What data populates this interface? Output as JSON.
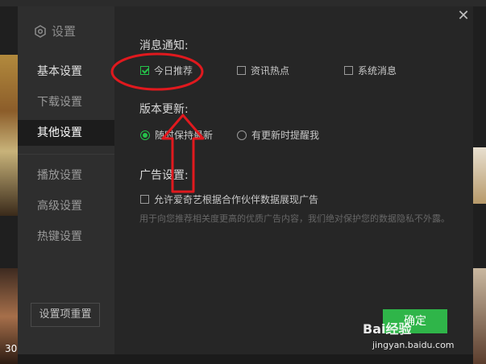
{
  "sidebar": {
    "title": "设置",
    "items": [
      {
        "label": "基本设置"
      },
      {
        "label": "下载设置"
      },
      {
        "label": "其他设置"
      },
      {
        "label": "播放设置"
      },
      {
        "label": "高级设置"
      },
      {
        "label": "热键设置"
      }
    ],
    "reset_label": "设置项重置"
  },
  "sections": {
    "notify": {
      "title": "消息通知:",
      "options": [
        {
          "label": "今日推荐",
          "checked": true
        },
        {
          "label": "资讯热点",
          "checked": false
        },
        {
          "label": "系统消息",
          "checked": false
        }
      ]
    },
    "update": {
      "title": "版本更新:",
      "options": [
        {
          "label": "随时保持最新",
          "selected": true
        },
        {
          "label": "有更新时提醒我",
          "selected": false
        }
      ]
    },
    "ads": {
      "title": "广告设置:",
      "option": {
        "label": "允许爱奇艺根据合作伙伴数据展现广告",
        "checked": false
      },
      "description": "用于向您推荐相关度更高的优质广告内容，我们绝对保护您的数据隐私不外露。"
    }
  },
  "confirm_label": "确定",
  "background": {
    "episode_num": "30"
  },
  "watermark": {
    "brand": "Bai经验",
    "url": "jingyan.baidu.com"
  },
  "colors": {
    "accent": "#25c24a",
    "annotation": "#e0191e"
  }
}
